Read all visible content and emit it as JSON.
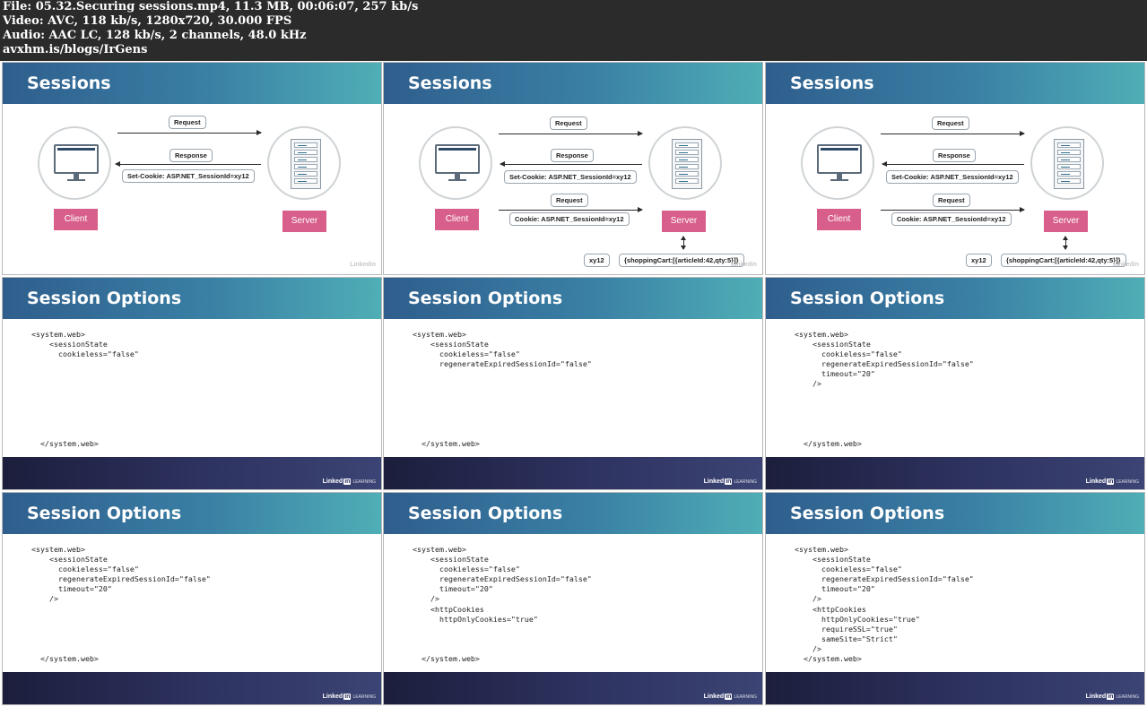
{
  "header": {
    "lines": [
      "File: 05.32.Securing sessions.mp4, 11.3 MB, 00:06:07, 257 kb/s",
      "Video: AVC, 118 kb/s, 1280x720, 30.000 FPS",
      "Audio: AAC LC, 128 kb/s, 2 channels, 48.0 kHz",
      "avxhm.is/blogs/IrGens"
    ]
  },
  "colors": {
    "header_bg": "#2b2b2b",
    "title_bar_start": "#2f5e8d",
    "title_bar_end": "#4faeb6",
    "pink_label": "#d85f8c",
    "footer_bg": "#2e3361"
  },
  "logo": {
    "name": "Linked",
    "in": "in",
    "learning": "LEARNING"
  },
  "slides": {
    "s1": {
      "title": "Sessions",
      "request": "Request",
      "response": "Response",
      "set_cookie": "Set-Cookie: ASP.NET_SessionId=xy12",
      "client": "Client",
      "server": "Server"
    },
    "s2": {
      "title": "Sessions",
      "request": "Request",
      "response": "Response",
      "set_cookie": "Set-Cookie: ASP.NET_SessionId=xy12",
      "request2": "Request",
      "cookie": "Cookie: ASP.NET_SessionId=xy12",
      "client": "Client",
      "server": "Server",
      "key": "xy12",
      "store": "{shoppingCart:[{articleId:42,qty:5}]}"
    },
    "s3": {
      "title": "Sessions",
      "request": "Request",
      "response": "Response",
      "set_cookie": "Set-Cookie: ASP.NET_SessionId=xy12",
      "request2": "Request",
      "cookie": "Cookie: ASP.NET_SessionId=xy12",
      "client": "Client",
      "server": "Server",
      "key": "xy12",
      "store": "{shoppingCart:[{articleId:42,qty:5}]}"
    },
    "s4": {
      "title": "Session Options",
      "lines": [
        "<system.web>",
        "    <sessionState",
        "      cookieless=\"false\""
      ],
      "close": "  </system.web>"
    },
    "s5": {
      "title": "Session Options",
      "lines": [
        "<system.web>",
        "    <sessionState",
        "      cookieless=\"false\"",
        "      regenerateExpiredSessionId=\"false\""
      ],
      "close": "  </system.web>"
    },
    "s6": {
      "title": "Session Options",
      "lines": [
        "<system.web>",
        "    <sessionState",
        "      cookieless=\"false\"",
        "      regenerateExpiredSessionId=\"false\"",
        "      timeout=\"20\"",
        "    />"
      ],
      "close": "  </system.web>"
    },
    "s7": {
      "title": "Session Options",
      "lines": [
        "<system.web>",
        "    <sessionState",
        "      cookieless=\"false\"",
        "      regenerateExpiredSessionId=\"false\"",
        "      timeout=\"20\"",
        "    />"
      ],
      "close": "  </system.web>"
    },
    "s8": {
      "title": "Session Options",
      "lines": [
        "<system.web>",
        "    <sessionState",
        "      cookieless=\"false\"",
        "      regenerateExpiredSessionId=\"false\"",
        "      timeout=\"20\"",
        "    />",
        "    <httpCookies",
        "      httpOnlyCookies=\"true\""
      ],
      "close": "  </system.web>"
    },
    "s9": {
      "title": "Session Options",
      "lines": [
        "<system.web>",
        "    <sessionState",
        "      cookieless=\"false\"",
        "      regenerateExpiredSessionId=\"false\"",
        "      timeout=\"20\"",
        "    />",
        "    <httpCookies",
        "      httpOnlyCookies=\"true\"",
        "      requireSSL=\"true\"",
        "      sameSite=\"Strict\"",
        "    />",
        "  </system.web>"
      ],
      "close": ""
    }
  }
}
